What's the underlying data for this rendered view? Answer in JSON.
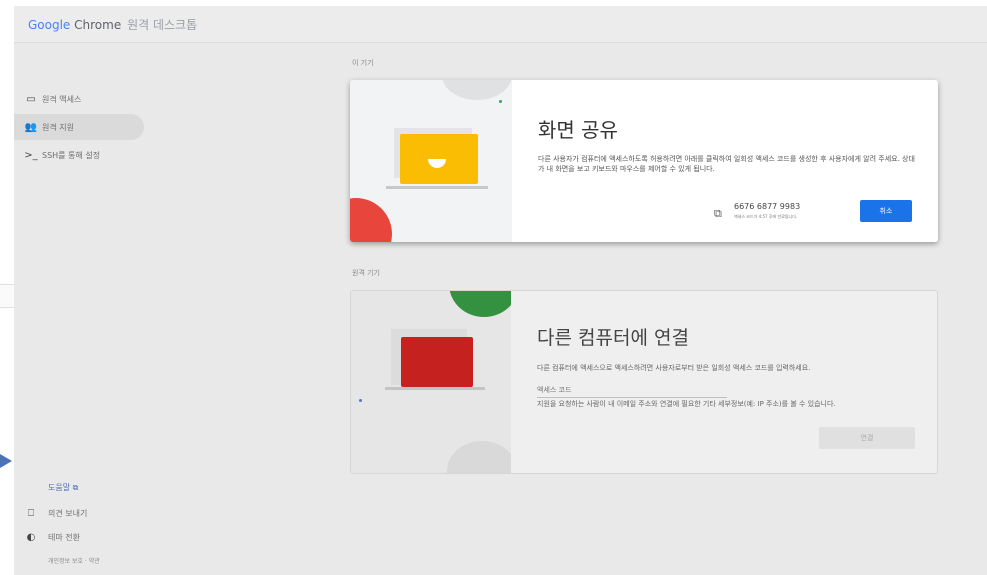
{
  "app": {
    "logo_google": "Google",
    "logo_chrome": "Chrome",
    "product": "원격 데스크톱"
  },
  "sidebar": {
    "items": [
      {
        "label": "원격 액세스",
        "icon": "laptop-icon"
      },
      {
        "label": "원격 지원",
        "icon": "people-icon"
      },
      {
        "label": "SSH를 통해 설정",
        "icon": "terminal-icon"
      }
    ],
    "help": "도움말 ⧉",
    "feedback": "의견 보내기",
    "theme": "테마 전환",
    "legal": "개인정보 보호 · 약관"
  },
  "this_device": {
    "label": "이 기기"
  },
  "share_dialog": {
    "title": "화면 공유",
    "description": "다른 사용자가 컴퓨터에 액세스하도록 허용하려면 아래를 클릭하여 일회성 액세스 코드를 생성한 후 사용자에게 알려 주세요. 상대가 내 화면을 보고 키보드와 마우스를 제어할 수 있게 됩니다.",
    "code": "6676 6877 9983",
    "code_expiry": "액세스 코드가 4:57 후에 만료됩니다.",
    "cancel_label": "취소"
  },
  "remote_device": {
    "label": "원격 기기"
  },
  "connect_card": {
    "title": "다른 컴퓨터에 연결",
    "description": "다른 컴퓨터에 액세스으로 액세스하려면 사용자로부터 받은 일회성 액세스 코드를 입력하세요.",
    "input_placeholder": "액세스 코드",
    "hint": "지원을 요청하는 사람이 내 이메일 주소와 연결에 필요한 기타 세부정보(예: IP 주소)를 볼 수 있습니다.",
    "connect_label": "연결"
  },
  "colors": {
    "accent": "#1a73e8",
    "share_art": "#fbbc04",
    "connect_art": "#c5221f",
    "blob_red": "#e8453c",
    "blob_green": "#33913f"
  }
}
